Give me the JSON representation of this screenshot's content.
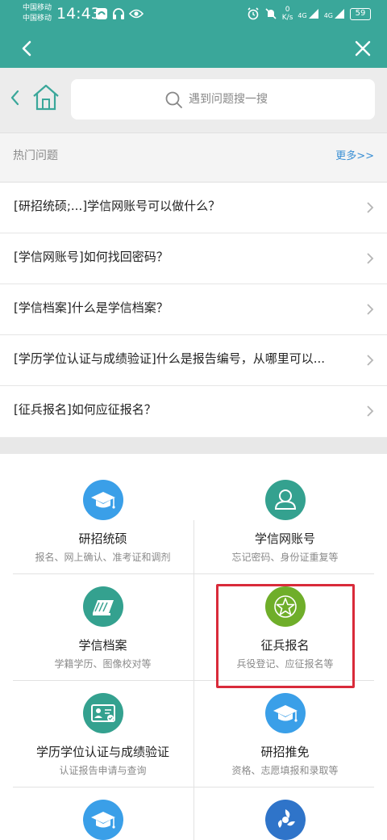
{
  "status_bar": {
    "carrier_1": "中国移动",
    "carrier_2": "中国移动",
    "time": "14:43",
    "net_speed_value": "0",
    "net_speed_unit": "K/s",
    "signal_1": "4G",
    "signal_2": "4G",
    "battery": "59"
  },
  "colors": {
    "header_bg": "#3aa79a",
    "link": "#3a8fd4",
    "blue_icon": "#3a9fe8",
    "teal_icon": "#34a18f",
    "green_icon": "#6fae2a",
    "highlight": "#d92b3a"
  },
  "search": {
    "placeholder": "遇到问题搜一搜"
  },
  "hot": {
    "title": "热门问题",
    "more": "更多>>"
  },
  "questions": [
    "[研招统硕;...]学信网账号可以做什么？",
    "[学信网账号]如何找回密码？",
    "[学信档案]什么是学信档案？",
    "[学历学位认证与成绩验证]什么是报告编号，从哪里可以...",
    "[征兵报名]如何应征报名？"
  ],
  "services": [
    {
      "title": "研招统硕",
      "subtitle": "报名、网上确认、准考证和调剂",
      "icon": "graduation-cap-icon"
    },
    {
      "title": "学信网账号",
      "subtitle": "忘记密码、身份证重复等",
      "icon": "user-icon"
    },
    {
      "title": "学信档案",
      "subtitle": "学籍学历、图像校对等",
      "icon": "files-icon"
    },
    {
      "title": "征兵报名",
      "subtitle": "兵役登记、应征报名等",
      "icon": "star-icon"
    },
    {
      "title": "学历学位认证与成绩验证",
      "subtitle": "认证报告申请与查询",
      "icon": "certificate-icon"
    },
    {
      "title": "研招推免",
      "subtitle": "资格、志愿填报和录取等",
      "icon": "graduation-cap-icon"
    },
    {
      "title": "",
      "subtitle": "",
      "icon": "graduation-cap-icon"
    },
    {
      "title": "",
      "subtitle": "",
      "icon": "pinwheel-icon"
    }
  ]
}
